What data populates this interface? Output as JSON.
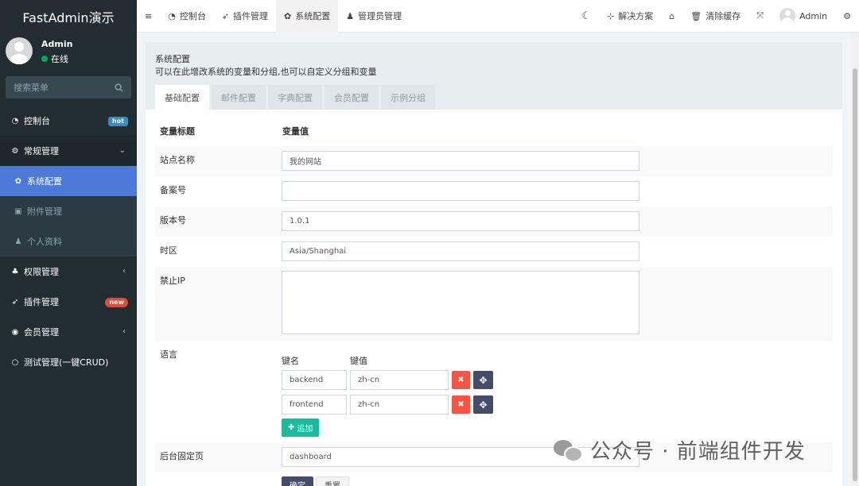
{
  "brand": "FastAdmin演示",
  "user": {
    "name": "Admin",
    "status": "在线"
  },
  "search": {
    "placeholder": "搜索菜单"
  },
  "menu": [
    {
      "label": "控制台",
      "icon": "dashboard-icon",
      "badge": "hot"
    },
    {
      "label": "常规管理",
      "icon": "cogs-icon"
    },
    {
      "label": "系统配置",
      "icon": "gear-icon"
    },
    {
      "label": "附件管理",
      "icon": "image-icon"
    },
    {
      "label": "个人资料",
      "icon": "user-icon"
    },
    {
      "label": "权限管理",
      "icon": "group-icon"
    },
    {
      "label": "插件管理",
      "icon": "rocket-icon",
      "badge": "new"
    },
    {
      "label": "会员管理",
      "icon": "user-circle-icon"
    },
    {
      "label": "测试管理(一键CRUD)",
      "icon": "circle-icon"
    }
  ],
  "topbar": {
    "tabs": [
      "控制台",
      "插件管理",
      "系统配置",
      "管理员管理"
    ],
    "solutions": "解决方案",
    "clear_cache": "清除缓存",
    "admin": "Admin"
  },
  "panel": {
    "title": "系统配置",
    "description": "可以在此增改系统的变量和分组,也可以自定义分组和变量",
    "tabs": [
      "基础配置",
      "邮件配置",
      "字典配置",
      "会员配置",
      "示例分组"
    ]
  },
  "table": {
    "col_name": "变量标题",
    "col_value": "变量值",
    "rows": [
      {
        "label": "站点名称",
        "value": "我的网站"
      },
      {
        "label": "备案号",
        "value": ""
      },
      {
        "label": "版本号",
        "value": "1.0.1"
      },
      {
        "label": "时区",
        "value": "Asia/Shanghai"
      },
      {
        "label": "禁止IP",
        "value": ""
      }
    ],
    "language": {
      "label": "语言",
      "key_header": "键名",
      "value_header": "键值",
      "entries": [
        {
          "key": "backend",
          "value": "zh-cn"
        },
        {
          "key": "frontend",
          "value": "zh-cn"
        }
      ],
      "add_label": "追加"
    },
    "fixed_page": {
      "label": "后台固定页",
      "value": "dashboard"
    },
    "ok_label": "确定",
    "reset_label": "重置"
  },
  "watermark": "公众号 · 前端组件开发"
}
